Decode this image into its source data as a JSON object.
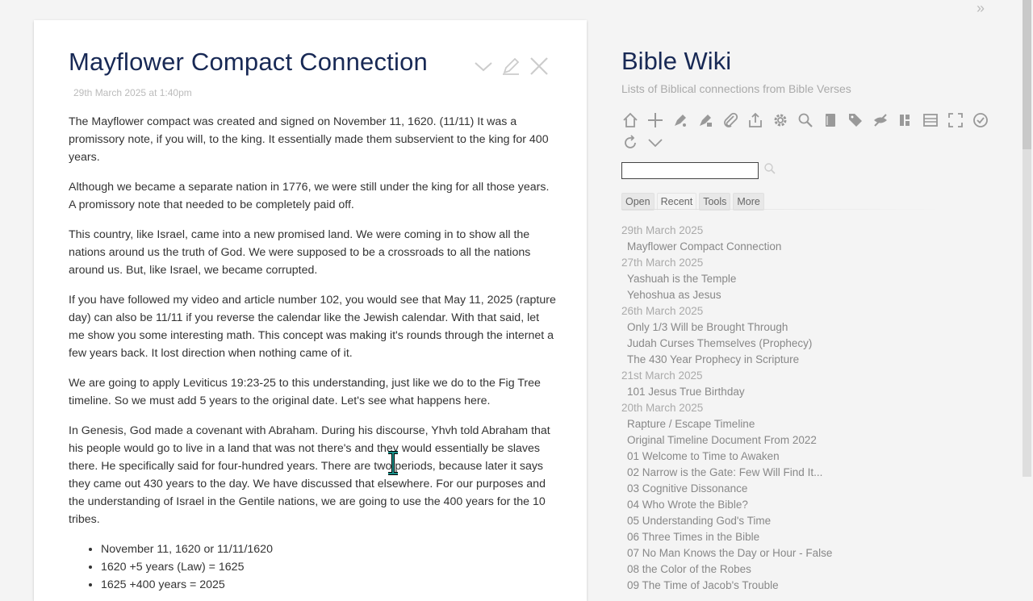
{
  "tiddler": {
    "title": "Mayflower Compact Connection",
    "date": "29th March 2025 at 1:40pm",
    "paragraphs": [
      "The Mayflower compact was created and signed on November 11, 1620. (11/11) It was a promissory note, if you will, to the king. It essentially made them subservient to the king for 400 years.",
      "Although we became a separate nation in 1776, we were still under the king for all those years. A promissory note that needed to be completely paid off.",
      "This country, like Israel, came into a new promised land. We were coming in to show all the nations around us the truth of God. We were supposed to be a crossroads to all the nations around us. But, like Israel, we became corrupted.",
      "If you have followed my video and article number 102, you would see that May 11, 2025 (rapture day) can also be 11/11 if you reverse the calendar like the Jewish calendar. With that said, let me show you some interesting math. This concept was making it's rounds through the internet a few years back. It lost direction when nothing came of it.",
      "We are going to apply Leviticus 19:23-25 to this understanding, just like we do to the Fig Tree timeline. So we must add 5 years to the original date. Let's see what happens here.",
      "In Genesis, God made a covenant with Abraham. During his discourse, Yhvh told Abraham that his people would go to live in a land that was not there's and they would essentially be slaves there. He specifically said for four-hundred years. There are two periods, because later it says they came out 430 years to the day. We have discussed that elsewhere. For our purposes and the understanding of Israel in the Gentile nations, we are going to use the 400 years for the 10 tribes."
    ],
    "bullets": [
      "November 11, 1620 or 11/11/1620",
      "1620 +5 years (Law) = 1625",
      "1625 +400 years = 2025"
    ]
  },
  "sidebar": {
    "title": "Bible Wiki",
    "subtitle": "Lists of Biblical connections from Bible Verses",
    "search_value": "",
    "tabs": [
      "Open",
      "Recent",
      "Tools",
      "More"
    ],
    "active_tab": "Recent",
    "recent": [
      {
        "date": "29th March 2025",
        "items": [
          "Mayflower Compact Connection"
        ]
      },
      {
        "date": "27th March 2025",
        "items": [
          "Yashuah is the Temple",
          "Yehoshua as Jesus"
        ]
      },
      {
        "date": "26th March 2025",
        "items": [
          "Only 1/3 Will be Brought Through",
          "Judah Curses Themselves (Prophecy)",
          "The 430 Year Prophecy in Scripture"
        ]
      },
      {
        "date": "21st March 2025",
        "items": [
          "101 Jesus True Birthday"
        ]
      },
      {
        "date": "20th March 2025",
        "items": [
          "Rapture / Escape Timeline",
          "Original Timeline Document From 2022",
          "01 Welcome to Time to Awaken",
          "02 Narrow is the Gate: Few Will Find It...",
          "03 Cognitive Dissonance",
          "04 Who Wrote the Bible?",
          "05 Understanding God's Time",
          "06 Three Times in the Bible",
          "07 No Man Knows the Day or Hour - False",
          "08 the Color of the Robes",
          "09 The Time of Jacob's Trouble"
        ]
      }
    ]
  },
  "colors": {
    "title": "#182955",
    "link": "#888888",
    "muted": "#aaaaaa"
  }
}
